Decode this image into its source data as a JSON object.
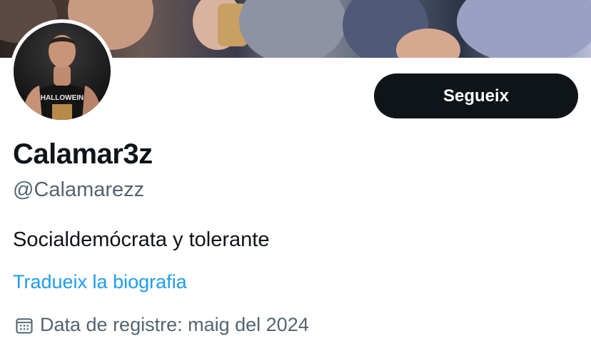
{
  "profile": {
    "display_name": "Calamar3z",
    "handle": "@Calamarezz",
    "bio": "Socialdemócrata y tolerante",
    "translate_bio_label": "Tradueix la biografia",
    "joined": {
      "icon": "calendar-icon",
      "text": "Data de registre: maig del 2024"
    },
    "avatar_shirt_text": "HALLOWEIN"
  },
  "actions": {
    "follow_label": "Segueix"
  },
  "colors": {
    "primary_text": "#0f1419",
    "secondary_text": "#536471",
    "link": "#1d9bf0",
    "button_bg": "#0f1419",
    "button_text": "#ffffff"
  }
}
